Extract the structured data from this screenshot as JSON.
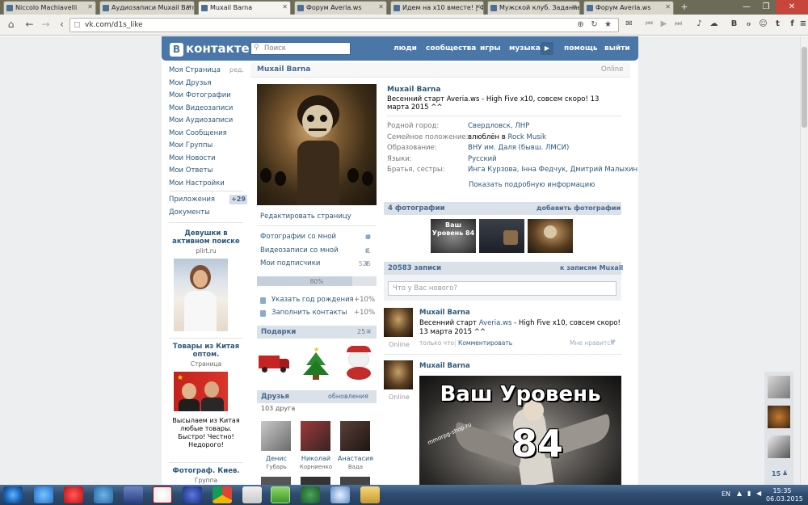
{
  "browser": {
    "tabs": [
      {
        "title": "Niccolo Machiavelli",
        "active": false
      },
      {
        "title": "Аудиозаписи Muxail Barn",
        "active": false
      },
      {
        "title": "Muxail Barna",
        "active": true
      },
      {
        "title": "Форум Averia.ws",
        "active": false
      },
      {
        "title": "Идем на x10 вместе! | Форум",
        "active": false
      },
      {
        "title": "Мужской клуб. Задание",
        "active": false
      },
      {
        "title": "Форум Averia.ws",
        "active": false
      }
    ],
    "new_tab": "+",
    "window_buttons": [
      "—",
      "❐",
      "✕"
    ],
    "url": "vk.com/d1s_like"
  },
  "vk": {
    "logo_text": "контакте",
    "logo_badge": "В",
    "search_placeholder": "Поиск",
    "top_nav": [
      "люди",
      "сообщества",
      "игры",
      "музыка",
      "помощь",
      "выйти"
    ],
    "left_menu": [
      "Моя Страница",
      "Мои Друзья",
      "Мои Фотографии",
      "Мои Видеозаписи",
      "Мои Аудиозаписи",
      "Мои Сообщения",
      "Мои Группы",
      "Мои Новости",
      "Мои Ответы",
      "Мои Настройки"
    ],
    "edit_label": "ред.",
    "apps_label": "Приложения",
    "apps_badge": "+29",
    "docs_label": "Документы",
    "ads": [
      {
        "title": "Девушки в активном поиске",
        "sub": "plirt.ru",
        "desc": ""
      },
      {
        "title": "Товары из Китая оптом.",
        "sub": "Страница",
        "desc": "Высылаем из Китая любые товары. Быстро! Честно! Недорого!"
      },
      {
        "title": "Фотограф. Киев.",
        "sub": "Группа",
        "desc": ""
      }
    ]
  },
  "profile": {
    "name": "Muxail Barna",
    "online": "Online",
    "edit_page": "Редактировать страницу",
    "stats": [
      {
        "label": "Фотографии со мной",
        "count": "0"
      },
      {
        "label": "Видеозаписи со мной",
        "count": "1"
      },
      {
        "label": "Мои подписчики",
        "count": "525"
      }
    ],
    "progress_percent": 80,
    "progress_label": "80%",
    "hints": [
      {
        "label": "Указать год рождения",
        "bonus": "+10%"
      },
      {
        "label": "Заполнить контакты",
        "bonus": "+10%"
      }
    ],
    "gifts_title": "Подарки",
    "gifts_count": "25",
    "friends_title": "Друзья",
    "friends_updates": "обновления",
    "friends_count": "103 друга",
    "friends": [
      {
        "first": "Денис",
        "last": "Губарь"
      },
      {
        "first": "Николай",
        "last": "Корниенко"
      },
      {
        "first": "Анастасия",
        "last": "Вада"
      }
    ],
    "status": "Весенний старт Averia.ws - High Five x10, совсем скоро! 13 марта 2015 ^^",
    "info": [
      {
        "label": "Родной город:",
        "value": "Свердловск, ЛНР"
      },
      {
        "label": "Семейное положение:",
        "value_plain": "влюблён в ",
        "value": "Rock Musik"
      },
      {
        "label": "Образование:",
        "value": "ВНУ им. Даля (бывш. ЛМСИ)"
      },
      {
        "label": "Языки:",
        "value": "Русский"
      },
      {
        "label": "Братья, сестры:",
        "value": "Инга Курзова, Інна Федчук, Дмитрий Малыхин"
      }
    ],
    "show_more": "Показать подробную информацию",
    "photos_title": "4 фотографии",
    "photos_add": "добавить фотографии",
    "photo_thumb_text": "Ваш Уровень 84",
    "wall_title": "20583 записи",
    "wall_link": "к записям Muxail",
    "wall_placeholder": "Что у Вас нового?",
    "posts": [
      {
        "author": "Muxail Barna",
        "text_before": "Весенний старт ",
        "link": "Averia.ws",
        "text_after": " - High Five x10, совсем скоро! 13 марта 2015 ^^",
        "time": "только что",
        "comment": "Комментировать",
        "like": "Мне нравится",
        "online": "Online"
      },
      {
        "author": "Muxail Barna",
        "online": "Online",
        "banner_title": "Ваш Уровень",
        "banner_number": "84",
        "banner_site": "mmorpg-shop.ru"
      }
    ]
  },
  "sidebar_right": {
    "count": "15"
  },
  "taskbar": {
    "lang": "EN",
    "time": "15:35",
    "date": "06.03.2015"
  },
  "colors": {
    "vk_blue": "#4a76a8",
    "link": "#2b587a",
    "taskbar": "#2f4d70"
  }
}
